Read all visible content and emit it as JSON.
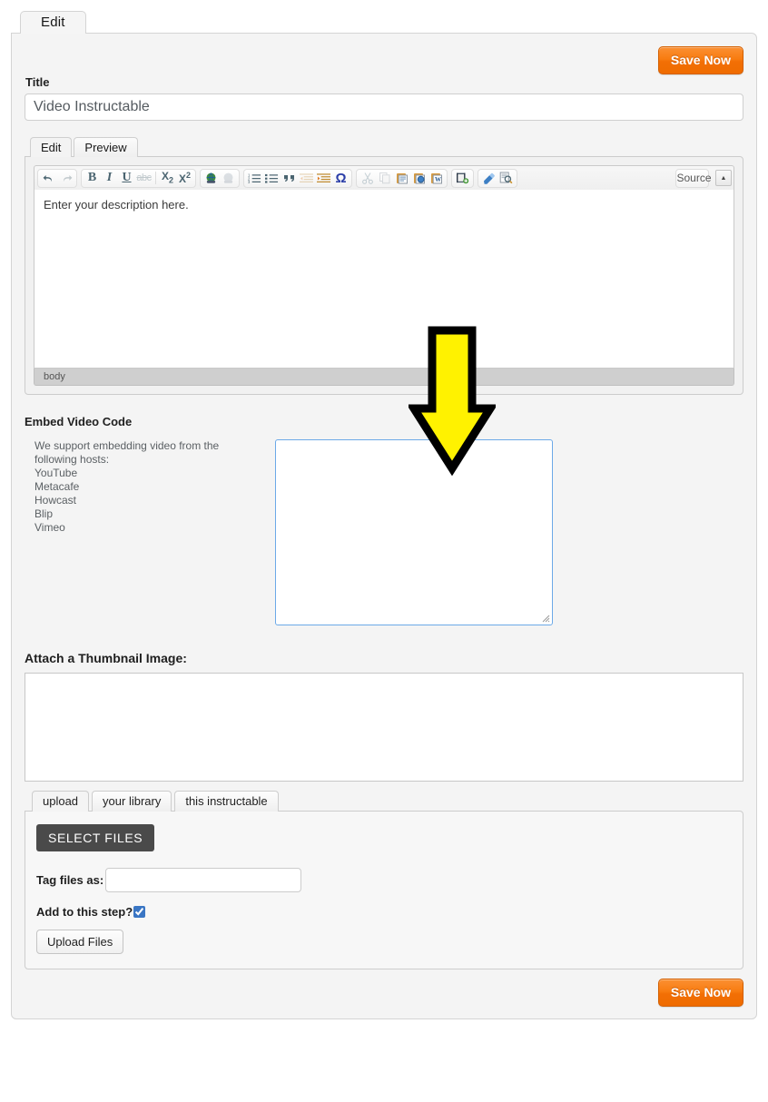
{
  "window": {
    "outer_tab_label": "Edit"
  },
  "toolbar": {
    "save_label": "Save Now",
    "save_label_bottom": "Save Now"
  },
  "title_field": {
    "label": "Title",
    "value": "Video Instructable",
    "placeholder": ""
  },
  "editor": {
    "tabs": [
      {
        "label": "Edit",
        "active": true
      },
      {
        "label": "Preview",
        "active": false
      }
    ],
    "body_text": "Enter your description here.",
    "status_path": "body",
    "source_label": "Source",
    "buttons": [
      {
        "name": "undo-icon",
        "group": 0,
        "disabled": false
      },
      {
        "name": "redo-icon",
        "group": 0,
        "disabled": true
      },
      {
        "name": "bold-icon",
        "group": 1,
        "disabled": false
      },
      {
        "name": "italic-icon",
        "group": 1,
        "disabled": false
      },
      {
        "name": "underline-icon",
        "group": 1,
        "disabled": false
      },
      {
        "name": "strikethrough-icon",
        "group": 1,
        "disabled": false
      },
      {
        "name": "subscript-icon",
        "group": 1,
        "disabled": false
      },
      {
        "name": "superscript-icon",
        "group": 1,
        "disabled": false
      },
      {
        "name": "link-icon",
        "group": 2,
        "disabled": false
      },
      {
        "name": "unlink-icon",
        "group": 2,
        "disabled": true
      },
      {
        "name": "numbered-list-icon",
        "group": 3,
        "disabled": false
      },
      {
        "name": "bulleted-list-icon",
        "group": 3,
        "disabled": false
      },
      {
        "name": "blockquote-icon",
        "group": 3,
        "disabled": false
      },
      {
        "name": "outdent-icon",
        "group": 3,
        "disabled": true
      },
      {
        "name": "indent-icon",
        "group": 3,
        "disabled": false
      },
      {
        "name": "special-character-icon",
        "group": 3,
        "disabled": false
      },
      {
        "name": "cut-icon",
        "group": 4,
        "disabled": true
      },
      {
        "name": "copy-icon",
        "group": 4,
        "disabled": true
      },
      {
        "name": "paste-icon",
        "group": 4,
        "disabled": false
      },
      {
        "name": "paste-as-plain-text-icon",
        "group": 4,
        "disabled": false
      },
      {
        "name": "paste-from-word-icon",
        "group": 4,
        "disabled": false
      },
      {
        "name": "insert-media-icon",
        "group": 5,
        "disabled": false
      },
      {
        "name": "remove-format-icon",
        "group": 6,
        "disabled": false
      },
      {
        "name": "find-replace-icon",
        "group": 6,
        "disabled": false
      }
    ]
  },
  "embed": {
    "heading": "Embed Video Code",
    "hosts_intro": "We support embedding video from the following hosts:",
    "hosts": [
      "YouTube",
      "Metacafe",
      "Howcast",
      "Blip",
      "Vimeo"
    ],
    "textarea_value": "",
    "textarea_placeholder": "",
    "focus_border_color": "#6ca9e8"
  },
  "thumbnail": {
    "heading": "Attach a Thumbnail Image:"
  },
  "upload": {
    "tabs": [
      {
        "label": "upload",
        "active": true
      },
      {
        "label": "your library",
        "active": false
      },
      {
        "label": "this instructable",
        "active": false
      }
    ],
    "select_files_label": "SELECT FILES",
    "tag_label": "Tag files as:",
    "tag_value": "",
    "add_step_label": "Add to this step?",
    "add_step_checked": true,
    "upload_files_label": "Upload Files"
  },
  "annotation": {
    "arrow_name": "yellow-down-arrow",
    "fill": "#FFF200",
    "stroke": "#000000",
    "direction": "down"
  }
}
